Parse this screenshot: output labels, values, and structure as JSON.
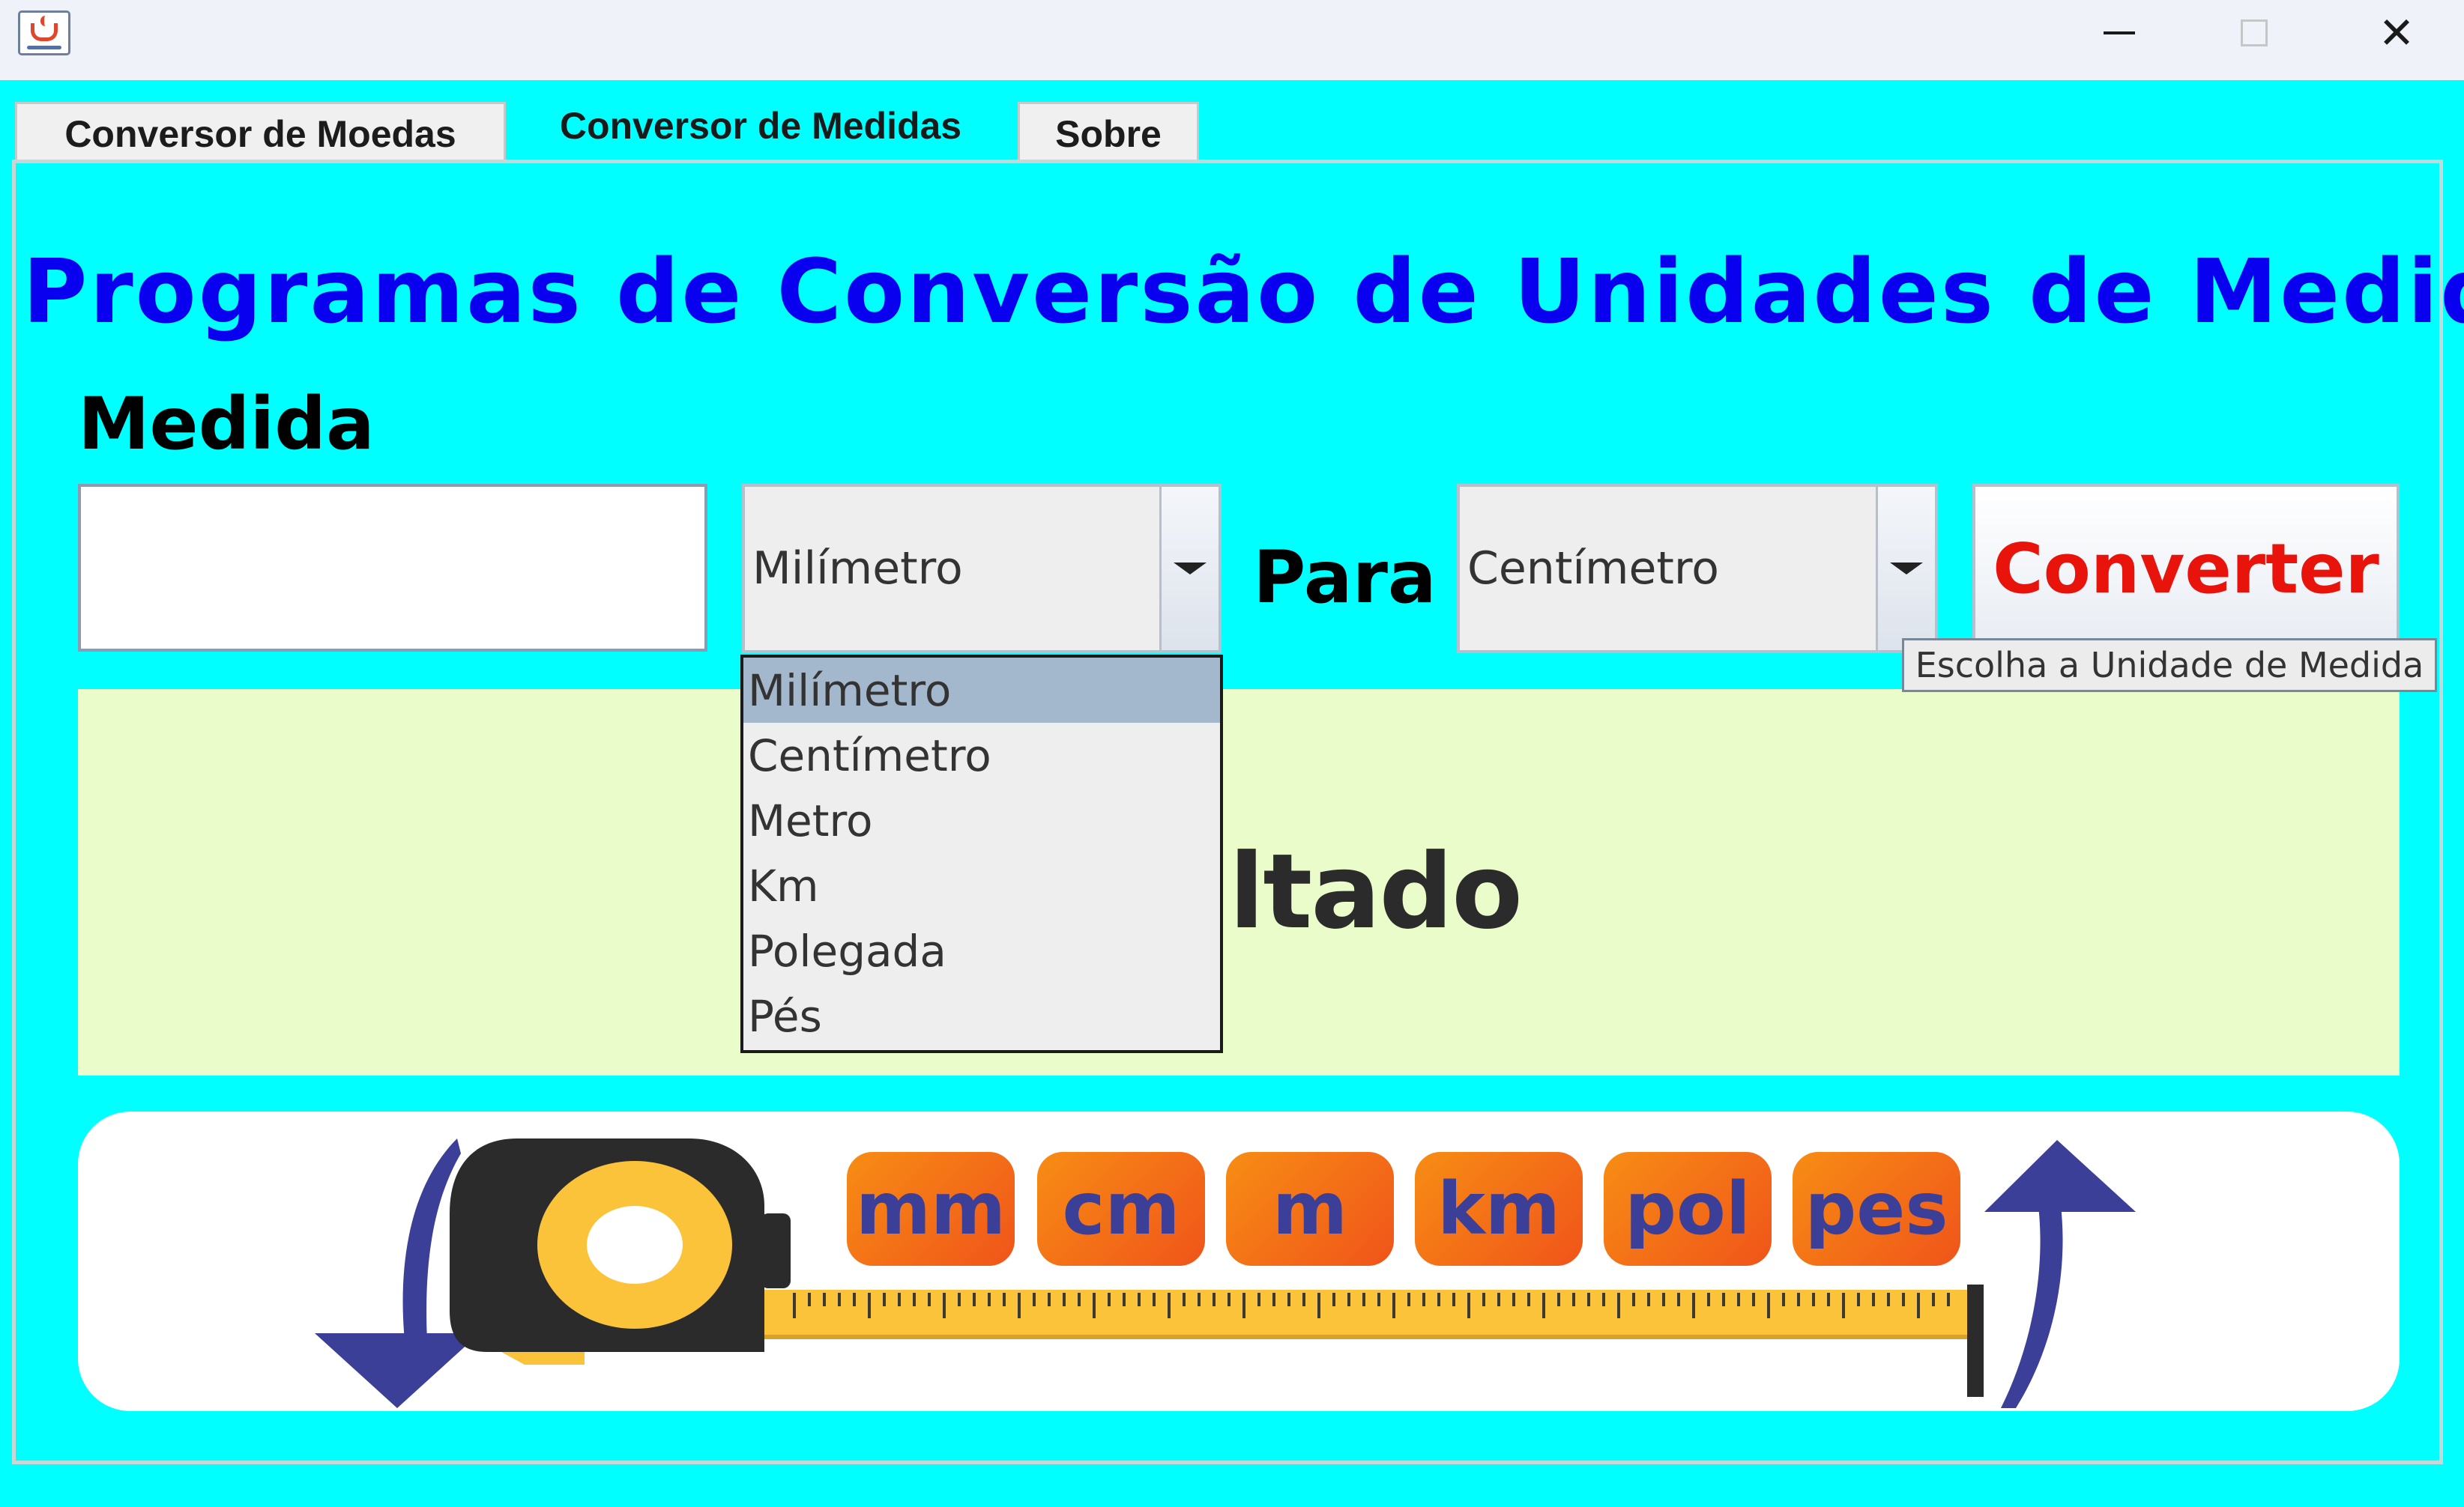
{
  "window": {
    "title": ""
  },
  "tabs": [
    {
      "label": "Conversor de Moedas",
      "active": false
    },
    {
      "label": "Conversor de Medidas",
      "active": true
    },
    {
      "label": "Sobre",
      "active": false
    }
  ],
  "main": {
    "heading": "Programas de Conversão de Unidades de Medida",
    "medida_label": "Medida",
    "value_input": {
      "value": "",
      "placeholder": ""
    },
    "from_unit": {
      "selected": "Milímetro",
      "options": [
        "Milímetro",
        "Centímetro",
        "Metro",
        "Km",
        "Polegada",
        "Pés"
      ],
      "open": true
    },
    "para_label": "Para",
    "to_unit": {
      "selected": "Centímetro"
    },
    "convert_button": "Converter",
    "tooltip": "Escolha a Unidade de Medida",
    "result_partial": "ltado"
  },
  "banner": {
    "chips": [
      "mm",
      "cm",
      "m",
      "km",
      "pol",
      "pes"
    ],
    "icons": [
      "arrow-down-icon",
      "tape-measure-icon",
      "arrow-up-icon"
    ]
  },
  "colors": {
    "background": "#00ffff",
    "heading": "#0a00f0",
    "convert_text": "#e8140c",
    "result_bg": "#ebfccb",
    "chip": "#f47a16",
    "chip_text": "#3b3f97",
    "arrow": "#3b3f97",
    "tape": "#fbc33a"
  }
}
